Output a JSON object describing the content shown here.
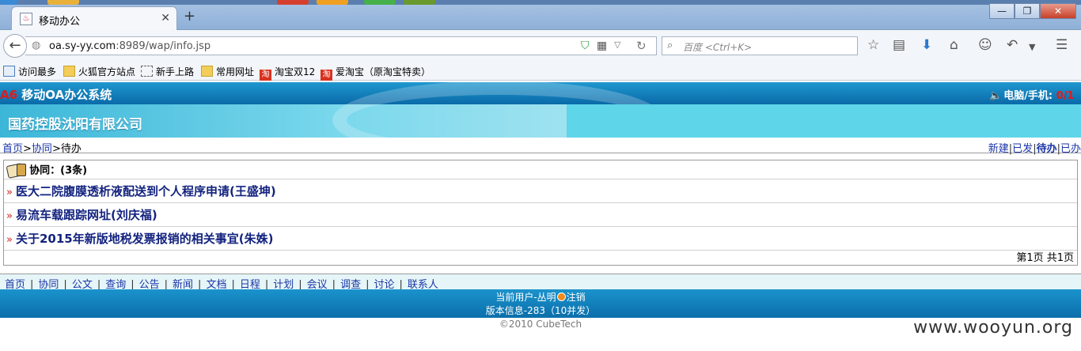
{
  "browser": {
    "tab_title": "移动办公",
    "tab_favicon": "♨",
    "url_host": "oa.sy-yy.com",
    "url_rest": ":8989/wap/info.jsp",
    "search_placeholder": "百度 <Ctrl+K>",
    "bookmarks": [
      {
        "label": "访问最多",
        "icon": "most-visited-icon"
      },
      {
        "label": "火狐官方站点",
        "icon": "folder-icon"
      },
      {
        "label": "新手上路",
        "icon": "page-icon"
      },
      {
        "label": "常用网址",
        "icon": "folder-icon"
      },
      {
        "label": "淘宝双12",
        "icon": "taobao-icon"
      },
      {
        "label": "爱淘宝（原淘宝特卖）",
        "icon": "taobao-icon"
      }
    ],
    "taobao_glyph": "淘"
  },
  "header": {
    "brand_prefix": "A6",
    "brand_name": " 移动OA办公系统",
    "device_label": "电脑/手机: ",
    "device_count": "0/1"
  },
  "banner": {
    "company": "国药控股沈阳有限公司"
  },
  "breadcrumb": {
    "home": "首页",
    "sep": ">",
    "section": "协同",
    "current": "待办"
  },
  "filters": [
    "新建",
    "已发",
    "待办",
    "已办"
  ],
  "filters_current_index": 2,
  "list": {
    "heading": "协同：(3条)",
    "items": [
      "医大二院腹膜透析液配送到个人程序申请(王盛坤)",
      "易流车载跟踪网址(刘庆福)",
      "关于2015年新版地税发票报销的相关事宜(朱姝)"
    ],
    "item_marker": "»",
    "pager": "第1页 共1页"
  },
  "footer": {
    "nav": [
      "首页",
      "协同",
      "公文",
      "查询",
      "公告",
      "新闻",
      "文档",
      "日程",
      "计划",
      "会议",
      "调查",
      "讨论",
      "联系人"
    ],
    "nav_sep": "|",
    "user_text": "当前用户-丛明",
    "logout": "注销",
    "version": "版本信息-283（10并发）",
    "copyright": "©2010 CubeTech"
  },
  "watermark": "www.wooyun.org",
  "colors": {
    "header_blue": "#0a6aa8",
    "accent_red": "#e01a1a",
    "link_blue": "#1a35a6",
    "banner_cyan": "#5ed5e8"
  }
}
